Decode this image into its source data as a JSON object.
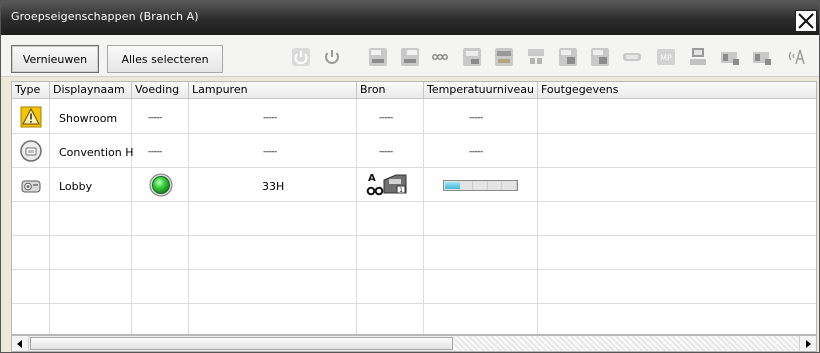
{
  "window": {
    "title": "Groepseigenschappen (Branch A)"
  },
  "toolbar": {
    "refresh_label": "Vernieuwen",
    "select_all_label": "Alles selecteren",
    "icons": [
      "power-on-icon",
      "power-off-icon",
      "input-computer1-icon",
      "input-computer2-icon",
      "input-video-icon",
      "input-svideo-icon",
      "input-component-icon",
      "input-hdmi-icon",
      "input-dvi1-icon",
      "input-dvi2-icon",
      "input-displayport-icon",
      "input-mp-icon",
      "input-usb-display-icon",
      "input-network-icon",
      "input-lan1-icon",
      "input-wireless-icon"
    ],
    "mp_label": "MP"
  },
  "columns": [
    "Type",
    "Displaynaam",
    "Voeding",
    "Lampuren",
    "Bron",
    "Temperatuurniveau",
    "Foutgegevens"
  ],
  "rows": [
    {
      "type_icon": "warning-projector-icon",
      "name": "Showroom",
      "power": "-----",
      "lamp_hours": "-----",
      "source": "-----",
      "temperature": "-----",
      "error": ""
    },
    {
      "type_icon": "disconnected-projector-icon",
      "name": "Convention H",
      "power": "-----",
      "lamp_hours": "-----",
      "source": "-----",
      "temperature": "-----",
      "error": ""
    },
    {
      "type_icon": "projector-icon",
      "name": "Lobby",
      "power_icon": "power-status-green-icon",
      "lamp_hours": "33H",
      "source_icon": "source-computer1-icon",
      "source_letter": "A",
      "source_num": "1",
      "temperature_level": 0.2,
      "error": ""
    }
  ],
  "colors": {
    "power_on": "#2fc93a",
    "temp_fill": "#3fb7d8",
    "warning": "#f3c400"
  }
}
